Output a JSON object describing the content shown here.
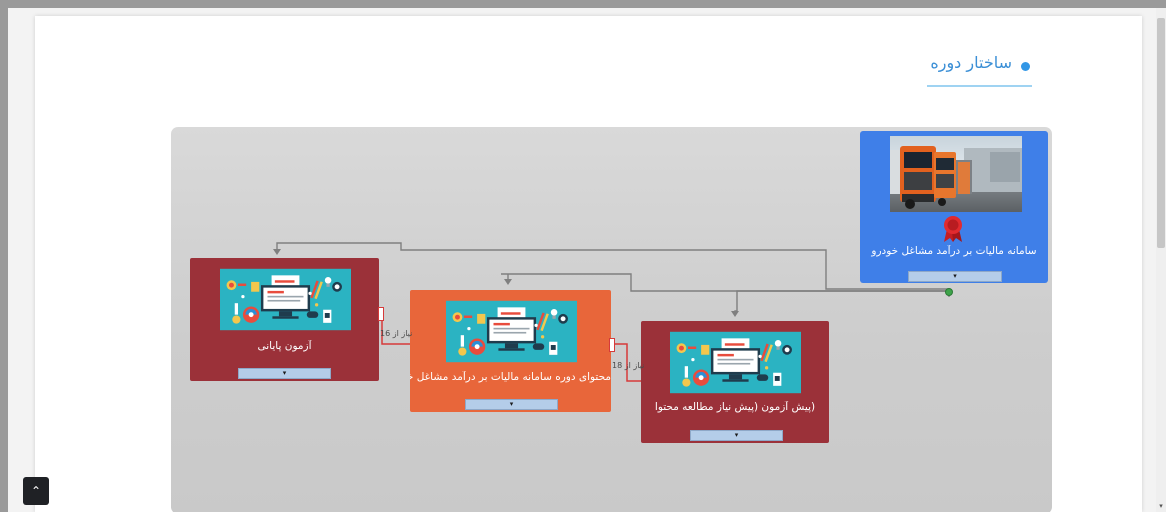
{
  "section": {
    "title": "ساختار دوره"
  },
  "course": {
    "title": "سامانه مالیات بر درآمد مشاغل خودرو",
    "expand_symbol": "▾",
    "award_icon": "ribbon-award-icon",
    "color": "#3f7fe8"
  },
  "nodes": [
    {
      "title": "آزمون پایانی",
      "expand_symbol": "▾",
      "color": "#9b3139"
    },
    {
      "title": "محتوای دوره سامانه مالیات بر درآمد مشاغل خودرو",
      "expand_symbol": "▾",
      "color": "#e8663a"
    },
    {
      "title": "(پیش آزمون (پیش نیاز مطالعه محتوا",
      "expand_symbol": "▾",
      "color": "#9b3139"
    }
  ],
  "prerequisites": [
    {
      "label": "نیاز از",
      "number": "16"
    },
    {
      "label": "نیاز از",
      "number": "18"
    }
  ],
  "back_to_top": {
    "symbol": "⌃"
  },
  "scrollbar": {
    "arrow": "▾"
  }
}
